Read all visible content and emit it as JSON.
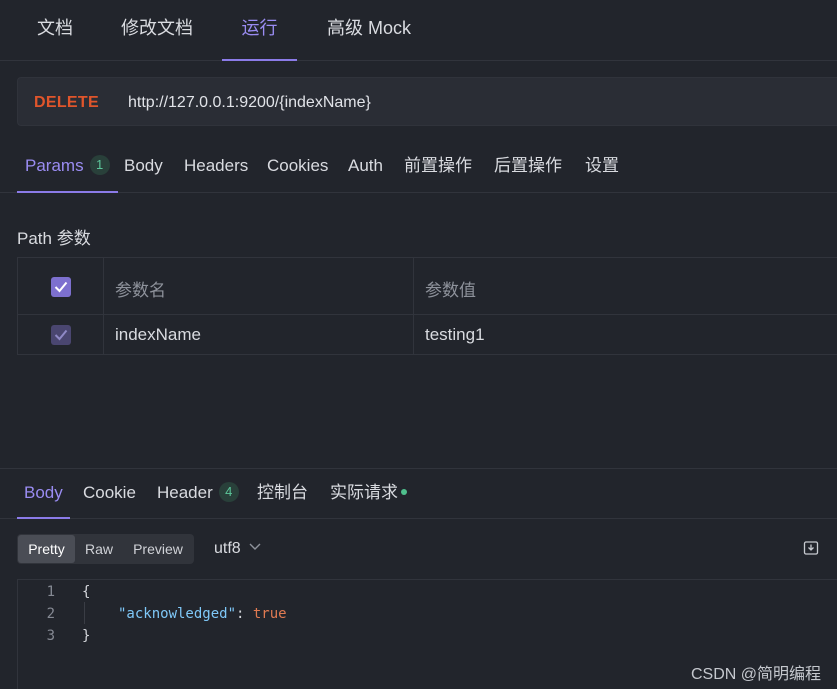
{
  "top_tabs": [
    "文档",
    "修改文档",
    "运行",
    "高级 Mock"
  ],
  "active_top_tab": "运行",
  "request": {
    "method": "DELETE",
    "url": "http://127.0.0.1:9200/{indexName}"
  },
  "request_tabs": {
    "params": "Params",
    "params_count": "1",
    "body": "Body",
    "headers": "Headers",
    "cookies": "Cookies",
    "auth": "Auth",
    "pre": "前置操作",
    "post": "后置操作",
    "settings": "设置"
  },
  "path_params": {
    "title": "Path 参数",
    "header_name": "参数名",
    "header_value": "参数值",
    "rows": [
      {
        "name": "indexName",
        "value": "testing1",
        "checked": true
      }
    ]
  },
  "response_tabs": {
    "body": "Body",
    "cookie": "Cookie",
    "header": "Header",
    "header_count": "4",
    "console": "控制台",
    "actual_request": "实际请求"
  },
  "view_modes": [
    "Pretty",
    "Raw",
    "Preview"
  ],
  "active_view_mode": "Pretty",
  "encoding": "utf8",
  "code_lines": [
    {
      "num": "1",
      "text": "{"
    },
    {
      "num": "2",
      "key": "\"acknowledged\"",
      "sep": ": ",
      "value": "true"
    },
    {
      "num": "3",
      "text": "}"
    }
  ],
  "watermark": "CSDN @简明编程",
  "colors": {
    "background": "#22252c",
    "accent": "#9a8cf2",
    "method_delete": "#e0552b",
    "badge_green": "#5cc69a",
    "json_key": "#7fc8f8",
    "json_bool": "#e07a52"
  },
  "icons": [
    "check-icon",
    "chevron-down-icon",
    "save-icon",
    "status-dot-icon"
  ]
}
